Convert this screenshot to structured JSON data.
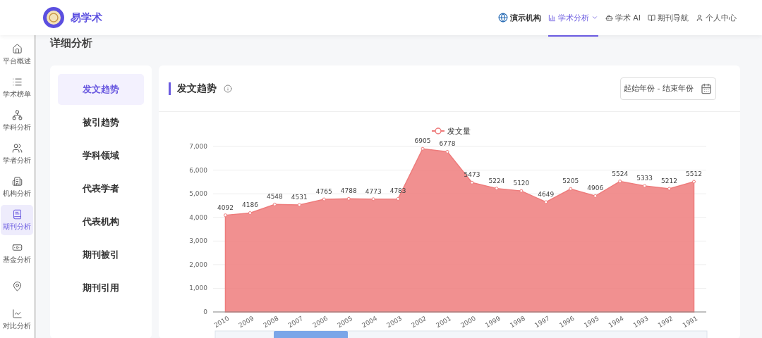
{
  "header": {
    "brand": "易学术",
    "nav": [
      {
        "label": "演示机构",
        "kind": "org",
        "selected": false
      },
      {
        "label": "学术分析",
        "kind": "analysis",
        "selected": true
      },
      {
        "label": "学术 AI",
        "kind": "ai",
        "selected": false
      },
      {
        "label": "期刊导航",
        "kind": "journal",
        "selected": false
      },
      {
        "label": "个人中心",
        "kind": "user",
        "selected": false
      }
    ]
  },
  "sidebar": {
    "items": [
      {
        "label": "平台概述",
        "selected": false
      },
      {
        "label": "学术榜单",
        "selected": false
      },
      {
        "label": "学科分析",
        "selected": false
      },
      {
        "label": "学者分析",
        "selected": false
      },
      {
        "label": "机构分析",
        "selected": false
      },
      {
        "label": "期刊分析",
        "selected": true
      },
      {
        "label": "基金分析",
        "selected": false
      },
      {
        "selected": false
      },
      {
        "label": "对比分析",
        "selected": false
      }
    ]
  },
  "page_title": "详细分析",
  "menu": [
    {
      "label": "发文趋势",
      "selected": true
    },
    {
      "label": "被引趋势",
      "selected": false
    },
    {
      "label": "学科领域",
      "selected": false
    },
    {
      "label": "代表学者",
      "selected": false
    },
    {
      "label": "代表机构",
      "selected": false
    },
    {
      "label": "期刊被引",
      "selected": false
    },
    {
      "label": "期刊引用",
      "selected": false
    }
  ],
  "panel": {
    "title": "发文趋势",
    "date_range": {
      "placeholder": "起始年份 - 结束年份"
    },
    "chart_data": {
      "type": "area",
      "categories": [
        "2010",
        "2009",
        "2008",
        "2007",
        "2006",
        "2005",
        "2004",
        "2003",
        "2002",
        "2001",
        "2000",
        "1999",
        "1998",
        "1997",
        "1996",
        "1995",
        "1994",
        "1993",
        "1992",
        "1991"
      ],
      "series": [
        {
          "name": "发文量",
          "color": "#ee7c7c",
          "values": [
            4092,
            4186,
            4548,
            4531,
            4765,
            4788,
            4773,
            4783,
            6905,
            6778,
            5473,
            5224,
            5120,
            4649,
            5205,
            4906,
            5524,
            5333,
            5212,
            5512
          ]
        }
      ],
      "ylim": [
        0,
        7000
      ],
      "yticks": [
        {
          "value": 0,
          "label": "0"
        },
        {
          "value": 1000,
          "label": "1,000"
        },
        {
          "value": 2000,
          "label": "2,000"
        },
        {
          "value": 3000,
          "label": "3,000"
        },
        {
          "value": 4000,
          "label": "4,000"
        },
        {
          "value": 5000,
          "label": "5,000"
        },
        {
          "value": 6000,
          "label": "6,000"
        },
        {
          "value": 7000,
          "label": "7,000"
        }
      ],
      "grid": true,
      "data_labels": true
    }
  }
}
